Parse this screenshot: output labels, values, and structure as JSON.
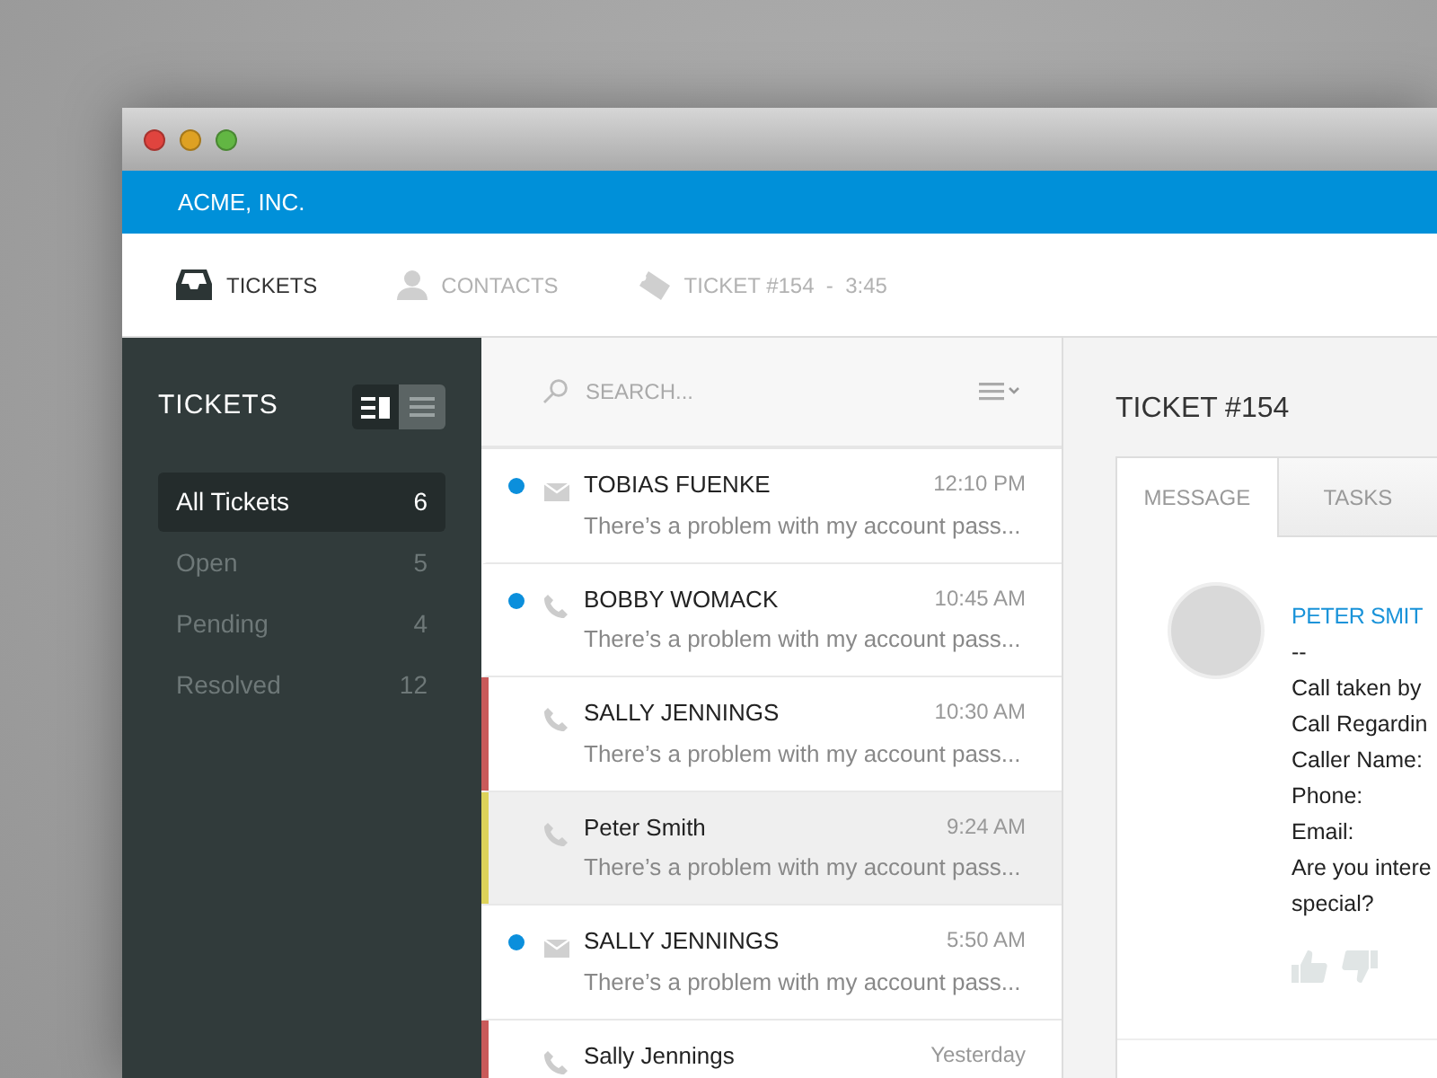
{
  "app_bar": {
    "company": "ACME, INC."
  },
  "nav": [
    {
      "kind": "inbox",
      "label": "TICKETS",
      "selected": true
    },
    {
      "kind": "person",
      "label": "CONTACTS",
      "selected": false
    },
    {
      "kind": "ticket",
      "label": "TICKET #154",
      "separator": "-",
      "extra": "3:45",
      "selected": false
    }
  ],
  "sidebar": {
    "title": "TICKETS",
    "view_toggle": [
      {
        "kind": "split",
        "selected": true
      },
      {
        "kind": "list",
        "selected": false
      }
    ],
    "items": [
      {
        "label": "All Tickets",
        "count": "6",
        "selected": true
      },
      {
        "label": "Open",
        "count": "5",
        "selected": false
      },
      {
        "label": "Pending",
        "count": "4",
        "selected": false
      },
      {
        "label": "Resolved",
        "count": "12",
        "selected": false
      }
    ]
  },
  "ticket_list": {
    "search": {
      "placeholder": "SEARCH..."
    },
    "rows": [
      {
        "kind": "email",
        "unread": true,
        "name": "TOBIAS FUENKE",
        "time": "12:10 PM",
        "preview": "There’s a problem with my account pass...",
        "selected": false
      },
      {
        "kind": "phone",
        "unread": true,
        "name": "BOBBY WOMACK",
        "time": "10:45 AM",
        "preview": "There’s a problem with my account pass...",
        "selected": false
      },
      {
        "kind": "phone",
        "unread": false,
        "color": "#c95a5a",
        "name": "SALLY JENNINGS",
        "time": "10:30 AM",
        "preview": "There’s a problem with my account pass...",
        "selected": false
      },
      {
        "kind": "phone",
        "unread": false,
        "color": "#ddd35a",
        "name": "Peter Smith",
        "time": "9:24 AM",
        "preview": "There’s a problem with my account pass...",
        "selected": true
      },
      {
        "kind": "email",
        "unread": true,
        "name": "SALLY JENNINGS",
        "time": "5:50 AM",
        "preview": "There’s a problem with my account pass...",
        "selected": false
      },
      {
        "kind": "phone",
        "unread": false,
        "color": "#c95a5a",
        "name": "Sally Jennings",
        "time": "Yesterday",
        "selected": false
      }
    ]
  },
  "detail": {
    "title": "TICKET #154",
    "tabs": [
      {
        "label": "MESSAGE",
        "selected": true
      },
      {
        "label": "TASKS",
        "selected": false
      }
    ],
    "message": {
      "sender": "PETER SMIT",
      "lines": [
        "--",
        "Call taken by",
        "Call Regardin",
        "Caller Name:",
        "Phone:",
        "Email:",
        "Are you intere",
        "special?"
      ]
    }
  }
}
